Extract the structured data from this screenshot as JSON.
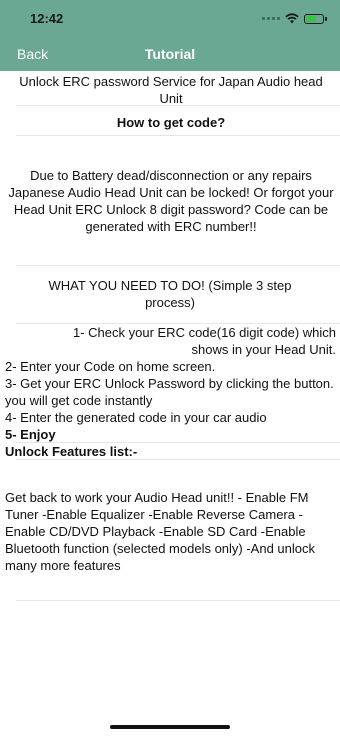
{
  "status_bar": {
    "time": "12:42",
    "signal_icon": "cellular-signal-icon",
    "wifi_icon": "wifi-icon",
    "battery_icon": "battery-charging-icon"
  },
  "nav": {
    "back_label": "Back",
    "title": "Tutorial"
  },
  "content": {
    "heading": "Unlock ERC password Service for Japan Audio head Unit",
    "subheading": "How to get code?",
    "intro": "Due to Battery dead/disconnection or any repairs Japanese Audio Head Unit can be locked! Or forgot your Head Unit ERC Unlock 8 digit password?  Code can be generated with ERC number!!",
    "steps_title": "WHAT YOU NEED TO DO! (Simple 3 step process)",
    "step1": "1-   Check your ERC code(16 digit code) which shows in your Head Unit.",
    "step2": "2-   Enter your Code on home screen.",
    "step3": "3-   Get your ERC Unlock Password by clicking the button. you will get code instantly",
    "step4": "4-   Enter the generated code in your car audio",
    "step5": "5-   Enjoy",
    "features_title": "Unlock Features list:-",
    "features": "Get back to work your Audio Head unit!!  - Enable FM Tuner    -Enable Equalizer   -Enable Reverse Camera    -Enable CD/DVD Playback   -Enable SD Card   -Enable Bluetooth function (selected models only)   -And unlock many more features"
  },
  "colors": {
    "header_bg": "#6aa893",
    "header_text": "#ffffff"
  }
}
